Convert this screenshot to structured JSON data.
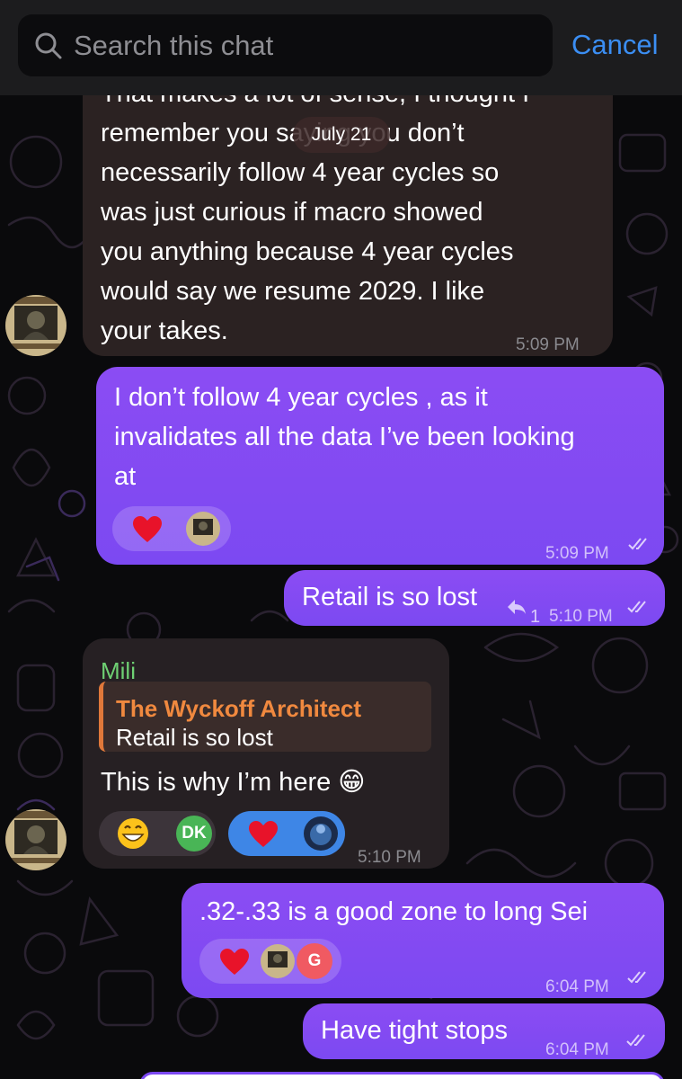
{
  "search": {
    "placeholder": "Search this chat",
    "cancel_label": "Cancel"
  },
  "date_pill": "July 21",
  "messages": [
    {
      "direction": "incoming",
      "lines": [
        "That makes a lot of sense, I thought I",
        "remember you saying you don’t",
        "necessarily follow 4 year cycles so",
        "was just curious if macro showed",
        "you anything because 4 year cycles",
        "would say we resume 2029. I like",
        "your takes."
      ],
      "time": "5:09 PM"
    },
    {
      "direction": "outgoing",
      "lines": [
        "I don’t follow 4 year cycles , as it",
        "invalidates all the data I’ve been looking",
        "at"
      ],
      "reactions": [
        "heart"
      ],
      "time": "5:09 PM"
    },
    {
      "direction": "outgoing",
      "text": "Retail is so lost",
      "reply_count": "1",
      "time": "5:10 PM"
    },
    {
      "direction": "incoming",
      "sender": "Mili",
      "quote": {
        "author": "The Wyckoff Architect",
        "text": "Retail is so lost"
      },
      "text": "This is why I’m here 😁",
      "reactions": [
        "grin",
        "heart"
      ],
      "reaction_initials": "DK",
      "time": "5:10 PM"
    },
    {
      "direction": "outgoing",
      "text": ".32-.33 is a good zone to long Sei",
      "reactions": [
        "heart"
      ],
      "reaction_initials": "G",
      "time": "6:04 PM"
    },
    {
      "direction": "outgoing",
      "text": "Have tight stops",
      "time": "6:04 PM"
    }
  ],
  "colors": {
    "outgoing_bubble": "#7c49f2",
    "incoming_bubble": "#2b2222",
    "accent_blue": "#3b8ef3",
    "sender_green": "#6ed073",
    "quote_orange": "#f0893f"
  }
}
